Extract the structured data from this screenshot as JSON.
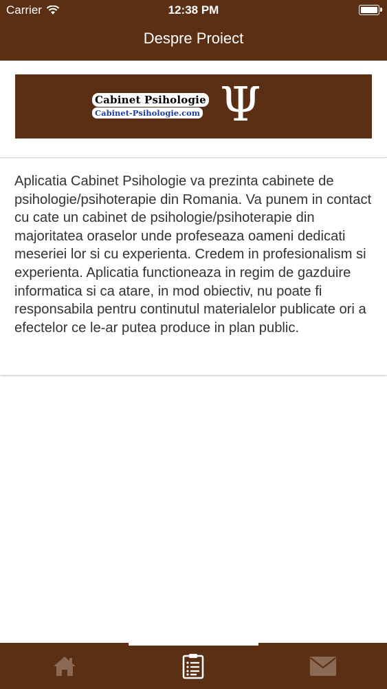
{
  "status_bar": {
    "carrier": "Carrier",
    "time": "12:38 PM"
  },
  "header": {
    "title": "Despre Proiect"
  },
  "banner": {
    "logo_line1": "Cabinet Psihologie",
    "logo_line2": "Cabinet-Psihologie.com",
    "symbol": "Ψ"
  },
  "content": {
    "paragraph": "Aplicatia Cabinet Psihologie va prezinta cabinete de psihologie/psihoterapie din Romania. Va punem in contact cu cate un cabinet de psihologie/psihoterapie din majoritatea oraselor unde profeseaza oameni dedicati meseriei lor si cu experienta. Credem in profesionalism si experienta. Aplicatia functioneaza in regim de gazduire informatica si ca atare, in mod obiectiv, nu poate fi responsabila pentru continutul materialelor publicate ori a efectelor ce le-ar putea produce in plan public."
  },
  "tab_bar": {
    "tabs": [
      {
        "icon": "home-icon",
        "selected": false
      },
      {
        "icon": "clipboard-icon",
        "selected": true
      },
      {
        "icon": "mail-icon",
        "selected": false
      }
    ]
  },
  "colors": {
    "brand_brown": "#5b2f14",
    "inactive_icon": "#8b6a55",
    "active_icon": "#ffffff"
  }
}
